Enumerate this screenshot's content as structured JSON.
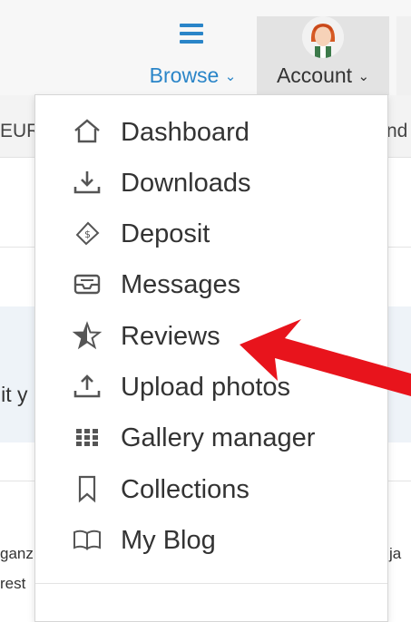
{
  "nav": {
    "browse_label": "Browse",
    "account_label": "Account",
    "caret": "⌄"
  },
  "background": {
    "strip_left_text": "EUR",
    "strip_right_text": "nd",
    "band_text": "lit y",
    "bottom_left_1": "ganz",
    "bottom_left_2": "rest",
    "bottom_right": "ja"
  },
  "menu": {
    "items": [
      {
        "label": "Dashboard",
        "icon": "home-icon"
      },
      {
        "label": "Downloads",
        "icon": "download-icon"
      },
      {
        "label": "Deposit",
        "icon": "money-tag-icon"
      },
      {
        "label": "Messages",
        "icon": "inbox-icon"
      },
      {
        "label": "Reviews",
        "icon": "star-icon"
      },
      {
        "label": "Upload photos",
        "icon": "upload-icon"
      },
      {
        "label": "Gallery manager",
        "icon": "grid-icon"
      },
      {
        "label": "Collections",
        "icon": "bookmark-icon"
      },
      {
        "label": "My Blog",
        "icon": "book-icon"
      }
    ]
  },
  "colors": {
    "accent_blue": "#2a85c8",
    "annotation_red": "#e8141c",
    "menu_border": "#d6d6d6"
  },
  "annotation": {
    "type": "red-arrow",
    "points_to": "Reviews"
  }
}
